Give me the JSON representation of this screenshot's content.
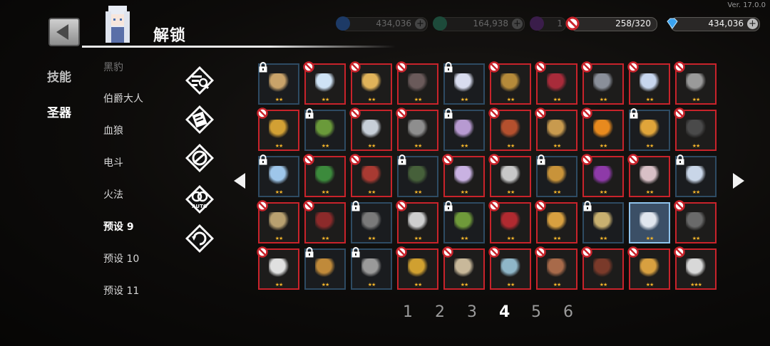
{
  "version": "Ver. 17.0.0",
  "header": {
    "title": "解锁"
  },
  "currency": {
    "stamina": "258/320",
    "gems": "434,036",
    "bg_values": [
      "434,036",
      "164,938",
      "1"
    ]
  },
  "categories": [
    {
      "label": "技能",
      "active": false
    },
    {
      "label": "圣器",
      "active": true
    }
  ],
  "presets": [
    {
      "label": "黑豹",
      "state": "faint"
    },
    {
      "label": "伯爵大人",
      "state": "normal"
    },
    {
      "label": "血狼",
      "state": "normal"
    },
    {
      "label": "电斗",
      "state": "normal"
    },
    {
      "label": "火法",
      "state": "normal"
    },
    {
      "label": "预设 9",
      "state": "hl"
    },
    {
      "label": "预设 10",
      "state": "normal"
    },
    {
      "label": "预设 11",
      "state": "normal"
    }
  ],
  "skill_icons": [
    "search-list-icon",
    "scroll-icon",
    "ring-icon",
    "auto-icon",
    "refresh-icon"
  ],
  "auto_label": "AUTO",
  "colors": {
    "ban_red": "#c9232b",
    "lock_blue": "#2e4b63",
    "select": "#8fc3ec",
    "star": "#f3b42a"
  },
  "relics": [
    {
      "state": "locked",
      "stars": 2,
      "name": "mask",
      "color": "#c9a36a"
    },
    {
      "state": "banned",
      "stars": 2,
      "name": "ice-cube",
      "color": "#cfe3f5"
    },
    {
      "state": "banned",
      "stars": 2,
      "name": "flowers",
      "color": "#e0b35a"
    },
    {
      "state": "banned",
      "stars": 2,
      "name": "dark-disc",
      "color": "#6a5a5a"
    },
    {
      "state": "locked",
      "stars": 2,
      "name": "crescent",
      "color": "#d8dcef"
    },
    {
      "state": "banned",
      "stars": 2,
      "name": "boots",
      "color": "#b58a3a"
    },
    {
      "state": "banned",
      "stars": 2,
      "name": "red-cape",
      "color": "#a82b3a"
    },
    {
      "state": "banned",
      "stars": 2,
      "name": "claw",
      "color": "#8a8f99"
    },
    {
      "state": "banned",
      "stars": 2,
      "name": "shield-orb",
      "color": "#c8d6ee"
    },
    {
      "state": "banned",
      "stars": 2,
      "name": "coin",
      "color": "#9a9a9a"
    },
    {
      "state": "banned",
      "stars": 2,
      "name": "medal",
      "color": "#d2a034"
    },
    {
      "state": "locked",
      "stars": 2,
      "name": "leaf",
      "color": "#6a9a3a"
    },
    {
      "state": "banned",
      "stars": 2,
      "name": "cloud",
      "color": "#c7cfd8"
    },
    {
      "state": "banned",
      "stars": 2,
      "name": "chain",
      "color": "#8e8e8e"
    },
    {
      "state": "locked",
      "stars": 2,
      "name": "crystal",
      "color": "#b79ad1"
    },
    {
      "state": "banned",
      "stars": 2,
      "name": "jar",
      "color": "#b4502e"
    },
    {
      "state": "banned",
      "stars": 2,
      "name": "mirror",
      "color": "#c89a4e"
    },
    {
      "state": "banned",
      "stars": 2,
      "name": "orange",
      "color": "#e88a1e"
    },
    {
      "state": "locked",
      "stars": 2,
      "name": "planet",
      "color": "#e0a53a"
    },
    {
      "state": "banned",
      "stars": 2,
      "name": "helmet",
      "color": "#4a4a4a"
    },
    {
      "state": "locked",
      "stars": 2,
      "name": "frost",
      "color": "#9ec6ea"
    },
    {
      "state": "banned",
      "stars": 2,
      "name": "moss",
      "color": "#3c8a3c"
    },
    {
      "state": "banned",
      "stars": 2,
      "name": "heart-stone",
      "color": "#a83a32"
    },
    {
      "state": "locked",
      "stars": 2,
      "name": "staff",
      "color": "#46603a"
    },
    {
      "state": "banned",
      "stars": 2,
      "name": "amethyst",
      "color": "#c9b2e2"
    },
    {
      "state": "banned",
      "stars": 2,
      "name": "letter",
      "color": "#c8c8c8"
    },
    {
      "state": "locked",
      "stars": 2,
      "name": "ring",
      "color": "#c8933a"
    },
    {
      "state": "banned",
      "stars": 2,
      "name": "dark-eye",
      "color": "#8e3aa8"
    },
    {
      "state": "banned",
      "stars": 2,
      "name": "shell",
      "color": "#d8c0c6"
    },
    {
      "state": "locked",
      "stars": 2,
      "name": "shard",
      "color": "#c9d6e8"
    },
    {
      "state": "banned",
      "stars": 2,
      "name": "knife",
      "color": "#b8a070"
    },
    {
      "state": "banned",
      "stars": 2,
      "name": "amulet",
      "color": "#8c2a2a"
    },
    {
      "state": "locked",
      "stars": 2,
      "name": "round-shield",
      "color": "#7a7a7a"
    },
    {
      "state": "banned",
      "stars": 2,
      "name": "wings",
      "color": "#cfcfcf"
    },
    {
      "state": "locked",
      "stars": 2,
      "name": "hat",
      "color": "#6f9a3a"
    },
    {
      "state": "banned",
      "stars": 2,
      "name": "glasses",
      "color": "#b02a30"
    },
    {
      "state": "banned",
      "stars": 2,
      "name": "spear",
      "color": "#d8a040"
    },
    {
      "state": "locked",
      "stars": 2,
      "name": "rune",
      "color": "#c8b070"
    },
    {
      "state": "selected",
      "stars": 2,
      "name": "cane",
      "color": "#e0e6ee"
    },
    {
      "state": "banned",
      "stars": 2,
      "name": "gear",
      "color": "#6a6a6a"
    },
    {
      "state": "banned",
      "stars": 2,
      "name": "scimitar",
      "color": "#e0e0e0"
    },
    {
      "state": "locked",
      "stars": 2,
      "name": "brick",
      "color": "#c08a3a"
    },
    {
      "state": "locked",
      "stars": 2,
      "name": "tent",
      "color": "#9a9a9a"
    },
    {
      "state": "banned",
      "stars": 2,
      "name": "gold-orb",
      "color": "#d0a030"
    },
    {
      "state": "banned",
      "stars": 2,
      "name": "box",
      "color": "#c8b89a"
    },
    {
      "state": "banned",
      "stars": 2,
      "name": "bowl",
      "color": "#8fb6c8"
    },
    {
      "state": "banned",
      "stars": 2,
      "name": "antler",
      "color": "#a86a4a"
    },
    {
      "state": "banned",
      "stars": 2,
      "name": "stone",
      "color": "#7a3a2a"
    },
    {
      "state": "banned",
      "stars": 2,
      "name": "scepter",
      "color": "#d8a040"
    },
    {
      "state": "banned",
      "stars": 3,
      "name": "potion",
      "color": "#d8d8d8"
    }
  ],
  "pagination": {
    "pages": [
      "1",
      "2",
      "3",
      "4",
      "5",
      "6"
    ],
    "active": "4"
  }
}
